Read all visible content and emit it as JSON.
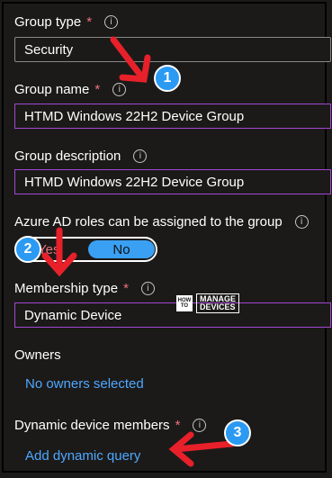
{
  "group_type": {
    "label": "Group type",
    "required_mark": "*",
    "info_glyph": "i",
    "value": "Security"
  },
  "group_name": {
    "label": "Group name",
    "required_mark": "*",
    "info_glyph": "i",
    "value": "HTMD Windows 22H2 Device Group"
  },
  "group_description": {
    "label": "Group description",
    "info_glyph": "i",
    "value": "HTMD Windows 22H2 Device Group"
  },
  "azure_roles": {
    "label": "Azure AD roles can be assigned to the group",
    "info_glyph": "i",
    "yes_label": "Yes",
    "no_label": "No",
    "selected": "No"
  },
  "membership_type": {
    "label": "Membership type",
    "required_mark": "*",
    "info_glyph": "i",
    "value": "Dynamic Device"
  },
  "owners": {
    "label": "Owners",
    "link": "No owners selected"
  },
  "dynamic_members": {
    "label": "Dynamic device members",
    "required_mark": "*",
    "info_glyph": "i",
    "link": "Add dynamic query"
  },
  "annotations": {
    "badge1": "1",
    "badge2": "2",
    "badge3": "3",
    "arrow_color": "#e8202a",
    "badge_color": "#2b9af3"
  },
  "watermark": {
    "how": "HOW TO",
    "manage": "MANAGE",
    "devices": "DEVICES"
  }
}
